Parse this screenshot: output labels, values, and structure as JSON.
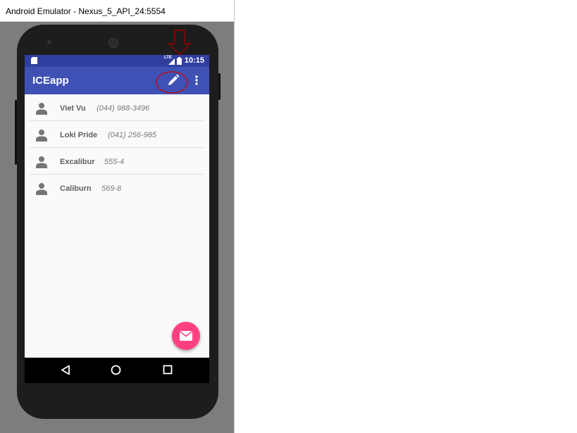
{
  "window": {
    "title": "Android Emulator - Nexus_5_API_24:5554"
  },
  "status_bar": {
    "network_label": "LTE",
    "time": "10:15"
  },
  "app_bar": {
    "title": "ICEapp",
    "edit_icon": "pencil-icon",
    "overflow_icon": "more-vert-icon"
  },
  "contacts": [
    {
      "name": "Viet Vu",
      "phone": "(044) 988-3496"
    },
    {
      "name": "Loki Pride",
      "phone": "(041) 256-985"
    },
    {
      "name": "Excalibur",
      "phone": "555-4"
    },
    {
      "name": "Caliburn",
      "phone": "569-8"
    }
  ],
  "fab": {
    "icon": "email-icon",
    "color": "#ff4081"
  },
  "nav_bar": {
    "icons": [
      "back-icon",
      "home-icon",
      "recents-icon"
    ]
  },
  "colors": {
    "primary": "#3f51b5",
    "primary_dark": "#303f9f",
    "accent": "#ff4081",
    "annotation": "#cc0000"
  }
}
